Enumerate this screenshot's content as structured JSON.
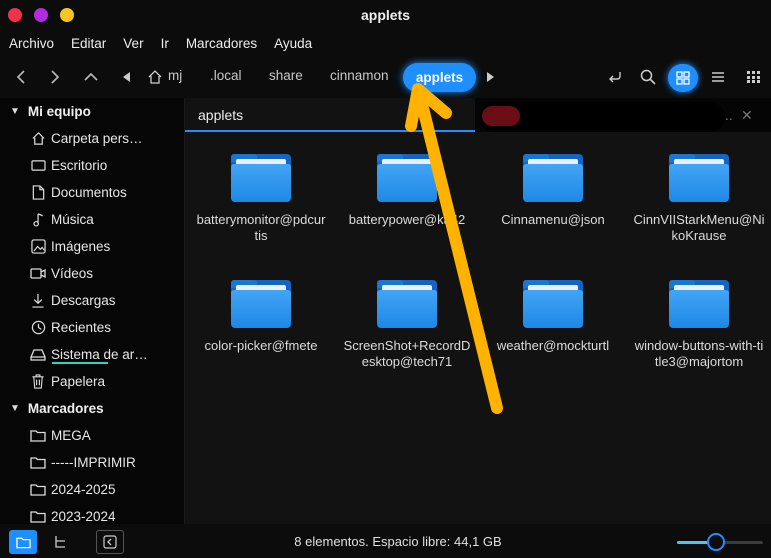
{
  "window": {
    "title": "applets"
  },
  "menubar": {
    "items": [
      "Archivo",
      "Editar",
      "Ver",
      "Ir",
      "Marcadores",
      "Ayuda"
    ]
  },
  "pathbar": {
    "crumbs": [
      "mj",
      ".local",
      "share",
      "cinnamon"
    ],
    "active": "applets"
  },
  "sidebar": {
    "section1": "Mi equipo",
    "items": [
      {
        "label": "Carpeta pers…",
        "icon": "home-icon"
      },
      {
        "label": "Escritorio",
        "icon": "desktop-icon"
      },
      {
        "label": "Documentos",
        "icon": "document-icon"
      },
      {
        "label": "Música",
        "icon": "music-icon"
      },
      {
        "label": "Imágenes",
        "icon": "image-icon"
      },
      {
        "label": "Vídeos",
        "icon": "video-icon"
      },
      {
        "label": "Descargas",
        "icon": "download-icon"
      },
      {
        "label": "Recientes",
        "icon": "clock-icon"
      },
      {
        "label": "Sistema de ar…",
        "icon": "drive-icon"
      },
      {
        "label": "Papelera",
        "icon": "trash-icon"
      }
    ],
    "section2": "Marcadores",
    "bookmarks": [
      "MEGA",
      "-----IMPRIMIR",
      "2024-2025",
      "2023-2024"
    ]
  },
  "tabs": {
    "active_label": "applets",
    "overflow": "..",
    "close": "✕"
  },
  "files": [
    "batterymonitor@pdcurtis",
    "batterypower@ka42",
    "Cinnamenu@json",
    "CinnVIIStarkMenu@NikoKrause",
    "color-picker@fmete",
    "ScreenShot+RecordDesktop@tech71",
    "weather@mockturtl",
    "window-buttons-with-title3@majortom"
  ],
  "statusbar": {
    "text": "8 elementos. Espacio libre: 44,1 GB",
    "zoom_level": 0.45
  },
  "colors": {
    "accent": "#1f8fff",
    "folder": "#1e88e5",
    "annotation_arrow": "#ffb300"
  }
}
